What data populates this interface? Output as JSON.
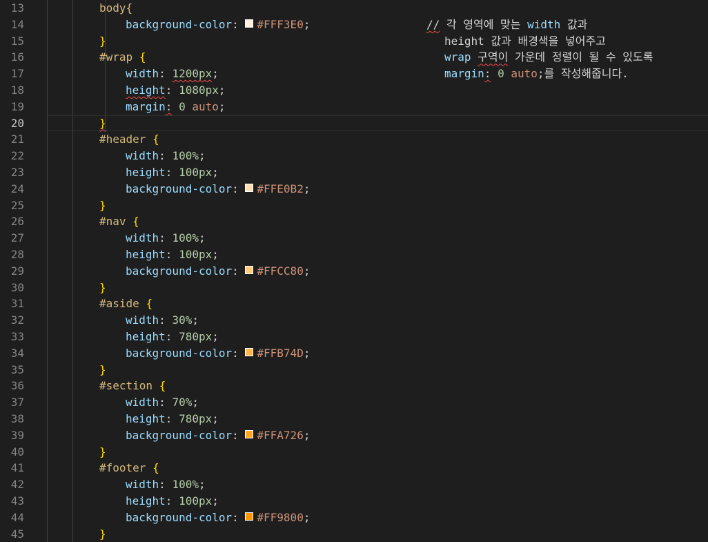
{
  "line_numbers": [
    "13",
    "14",
    "15",
    "16",
    "17",
    "18",
    "19",
    "20",
    "21",
    "22",
    "23",
    "24",
    "25",
    "26",
    "27",
    "28",
    "29",
    "30",
    "31",
    "32",
    "33",
    "34",
    "35",
    "36",
    "37",
    "38",
    "39",
    "40",
    "41",
    "42",
    "43",
    "44",
    "45"
  ],
  "active_line": "20",
  "rules": {
    "body": {
      "selector": "body{",
      "close": "}",
      "prop": "background-color",
      "color_value": "#FFF3E0",
      "swatch": "#FFF3E0"
    },
    "wrap": {
      "selector": "#wrap",
      "open": "{",
      "close": "}",
      "width_prop": "width",
      "width_val": "1200px",
      "height_prop": "height",
      "height_val": "1080px",
      "margin_prop": "margin",
      "margin_num": "0",
      "margin_kw": "auto"
    },
    "header": {
      "selector": "#header",
      "open": "{",
      "close": "}",
      "w_prop": "width",
      "w_val": "100%",
      "h_prop": "height",
      "h_val": "100px",
      "bg_prop": "background-color",
      "bg_val": "#FFE0B2",
      "swatch": "#FFE0B2"
    },
    "nav": {
      "selector": "#nav",
      "open": "{",
      "close": "}",
      "w_prop": "width",
      "w_val": "100%",
      "h_prop": "height",
      "h_val": "100px",
      "bg_prop": "background-color",
      "bg_val": "#FFCC80",
      "swatch": "#FFCC80"
    },
    "aside": {
      "selector": "#aside",
      "open": "{",
      "close": "}",
      "w_prop": "width",
      "w_val": "30%",
      "h_prop": "height",
      "h_val": "780px",
      "bg_prop": "background-color",
      "bg_val": "#FFB74D",
      "swatch": "#FFB74D"
    },
    "section": {
      "selector": "#section",
      "open": "{",
      "close": "}",
      "w_prop": "width",
      "w_val": "70%",
      "h_prop": "height",
      "h_val": "780px",
      "bg_prop": "background-color",
      "bg_val": "#FFA726",
      "swatch": "#FFA726"
    },
    "footer": {
      "selector": "#footer",
      "open": "{",
      "close": "}",
      "w_prop": "width",
      "w_val": "100%",
      "h_prop": "height",
      "h_val": "100px",
      "bg_prop": "background-color",
      "bg_val": "#FF9800",
      "swatch": "#FF9800"
    }
  },
  "comment": {
    "slashes": "//",
    "l1_text": " 각 영역에 맞는 ",
    "l1_kw": "width",
    "l1_tail": " 값과",
    "l2_kw": "height",
    "l2_text": " 값과 배경색을 넣어주고",
    "l3_kw": "wrap",
    "l3_sq": "구역이",
    "l3_text": " 가운데 정렬이 될 수 있도록",
    "l4_kw": "margin",
    "l4_colon": ":",
    "l4_num": " 0",
    "l4_val": " auto",
    "l4_text": ";를 작성해줍니다."
  }
}
